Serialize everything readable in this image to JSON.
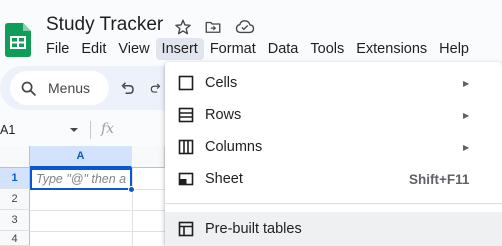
{
  "app": {
    "title": "Study Tracker",
    "title_icons": [
      "star-icon",
      "move-to-folder-icon",
      "cloud-status-icon"
    ],
    "brand_color": "#0f9d58"
  },
  "menubar": {
    "items": [
      "File",
      "Edit",
      "View",
      "Insert",
      "Format",
      "Data",
      "Tools",
      "Extensions",
      "Help"
    ],
    "active": "Insert"
  },
  "toolbar": {
    "search_label": "Menus",
    "icons": [
      "search-icon",
      "undo-icon",
      "redo-icon"
    ]
  },
  "formula_bar": {
    "cell_ref": "A1",
    "fx_label": "fx"
  },
  "grid": {
    "columns": [
      "A"
    ],
    "rows": [
      "1",
      "2",
      "3",
      "4"
    ],
    "selected_cell": "A1",
    "active_cell_placeholder": "Type \"@\" then a file na"
  },
  "insert_menu": {
    "items": [
      {
        "label": "Cells",
        "icon": "cells-icon",
        "submenu": true
      },
      {
        "label": "Rows",
        "icon": "rows-icon",
        "submenu": true
      },
      {
        "label": "Columns",
        "icon": "columns-icon",
        "submenu": true
      },
      {
        "label": "Sheet",
        "icon": "sheet-icon",
        "shortcut": "Shift+F11"
      },
      {
        "label": "Pre-built tables",
        "icon": "table-icon"
      }
    ],
    "submenu_arrow": "▶"
  }
}
